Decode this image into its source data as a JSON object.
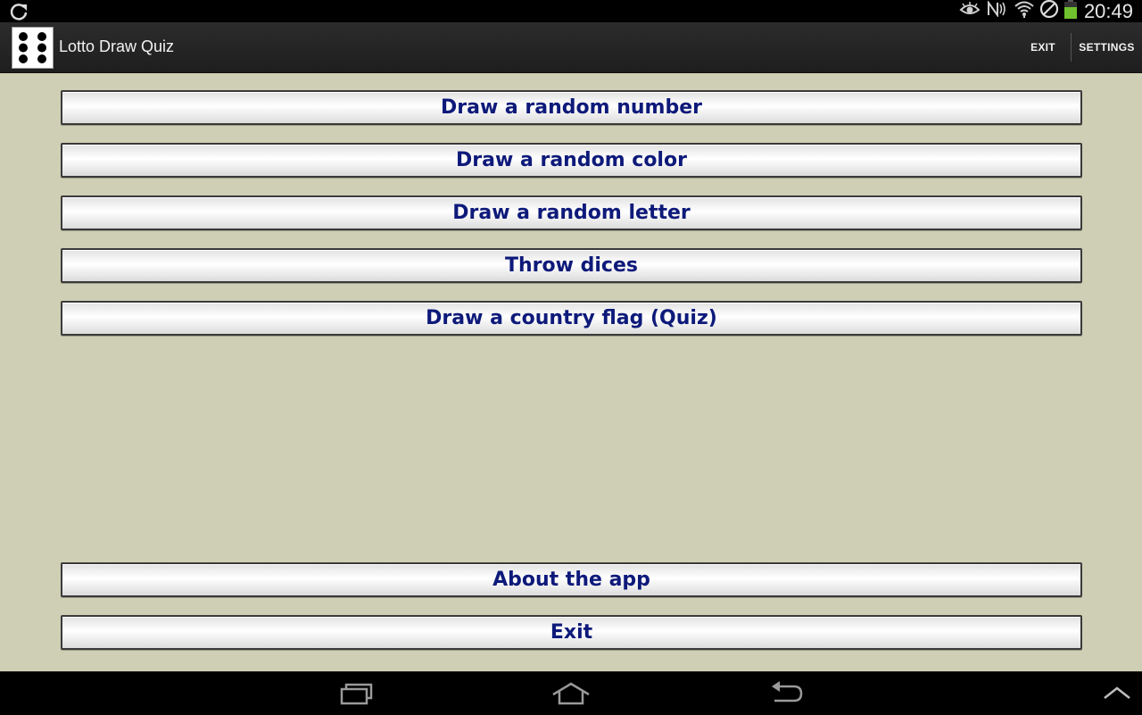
{
  "status_bar": {
    "time": "20:49",
    "icons": [
      "sync-icon",
      "eye-icon",
      "nfc-icon",
      "wifi-icon",
      "blocked-icon",
      "battery-icon"
    ]
  },
  "action_bar": {
    "title": "Lotto Draw Quiz",
    "exit_label": "EXIT",
    "settings_label": "SETTINGS"
  },
  "menu": {
    "buttons": [
      {
        "label": "Draw a random number"
      },
      {
        "label": "Draw a random color"
      },
      {
        "label": "Draw a random letter"
      },
      {
        "label": "Throw dices"
      },
      {
        "label": "Draw a country flag (Quiz)"
      }
    ],
    "about_label": "About the app",
    "exit_label": "Exit"
  },
  "colors": {
    "background": "#cfcfb5",
    "button_text": "#0e1a7a",
    "battery": "#6fc22d"
  },
  "nav_bar": {
    "icons": [
      "recent-apps-icon",
      "home-icon",
      "back-icon",
      "chevron-up-icon"
    ]
  }
}
